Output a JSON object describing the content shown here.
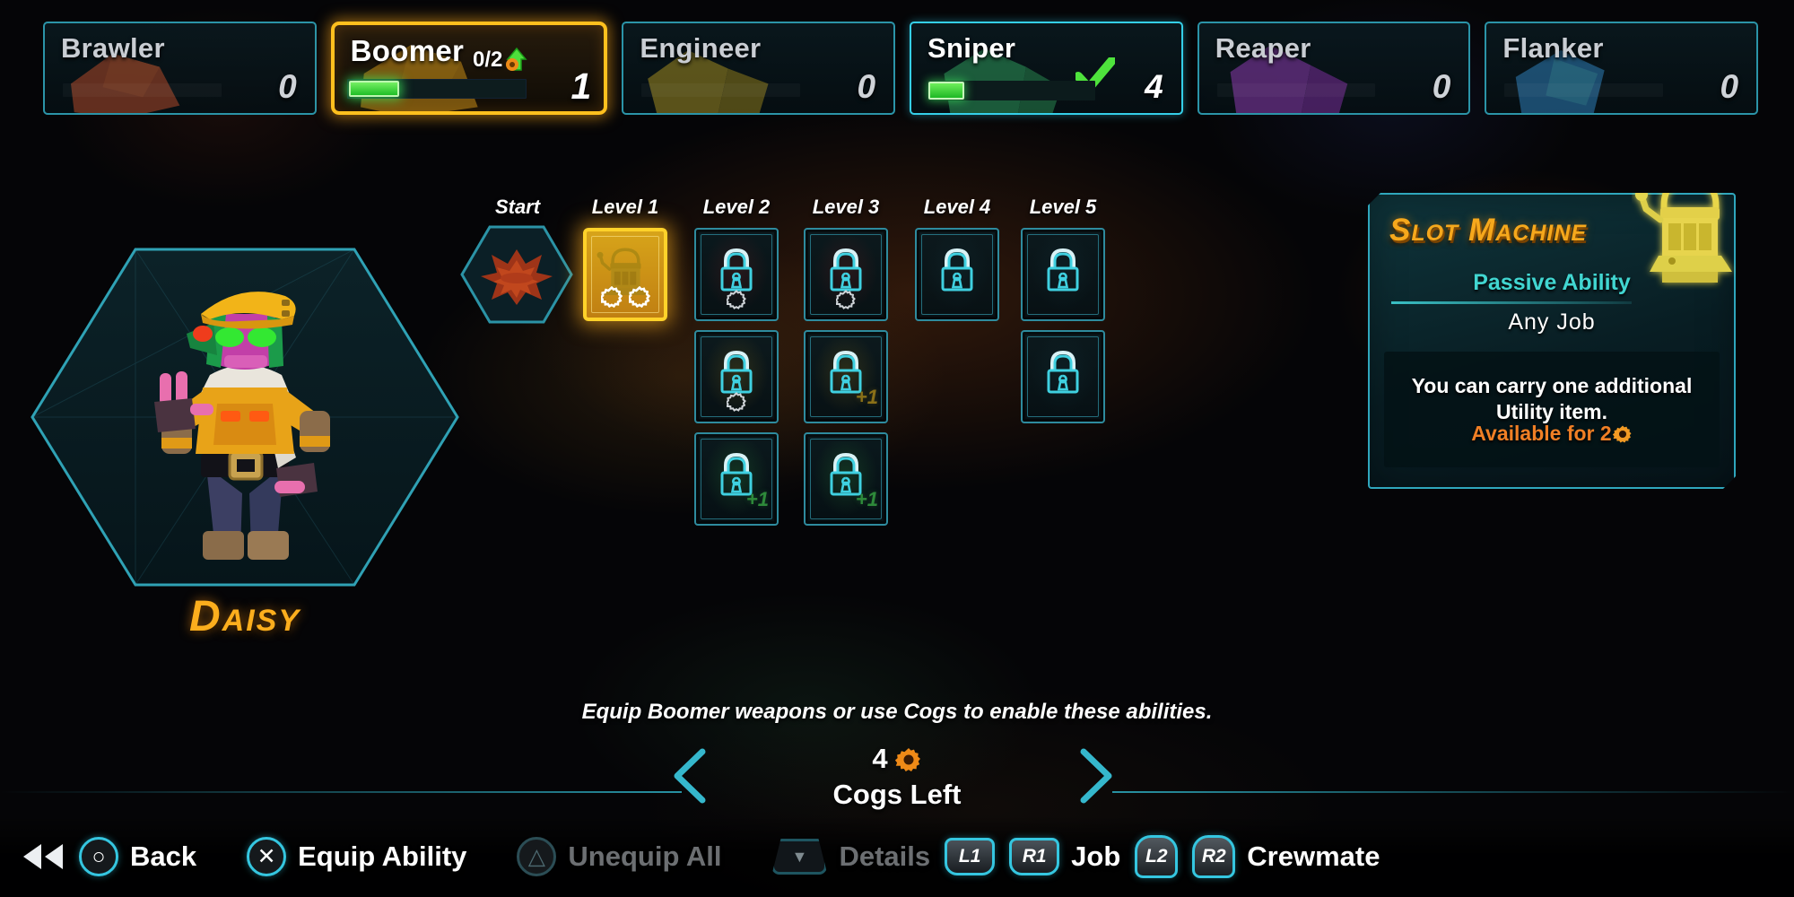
{
  "jobs": [
    {
      "name": "Brawler",
      "count": "0",
      "state": "locked",
      "accent": "#b04a2a"
    },
    {
      "name": "Boomer",
      "count": "1",
      "state": "selected",
      "accent": "#d89a18",
      "upgrade": "0/2",
      "progress": 8
    },
    {
      "name": "Engineer",
      "count": "0",
      "state": "locked",
      "accent": "#a08a22"
    },
    {
      "name": "Sniper",
      "count": "4",
      "state": "active",
      "accent": "#2f9a5c",
      "progress": 6,
      "checked": true
    },
    {
      "name": "Reaper",
      "count": "0",
      "state": "locked",
      "accent": "#8c3bb0"
    },
    {
      "name": "Flanker",
      "count": "0",
      "state": "locked",
      "accent": "#2f7fb8"
    }
  ],
  "character": {
    "name": "Daisy"
  },
  "tree": {
    "columns": [
      "Start",
      "Level 1",
      "Level 2",
      "Level 3",
      "Level 4",
      "Level 5"
    ],
    "nodes": [
      {
        "col": 0,
        "row": 0,
        "kind": "start",
        "icon": "explosion-icon",
        "state": "start",
        "cost": 0,
        "plus": ""
      },
      {
        "col": 1,
        "row": 0,
        "kind": "ability",
        "icon": "slot-machine-icon",
        "state": "selected",
        "cost": 2,
        "plus": ""
      },
      {
        "col": 2,
        "row": 0,
        "kind": "locked",
        "icon": "lock-icon",
        "state": "locked",
        "cost": 1,
        "plus": "",
        "tint": "#7a2020"
      },
      {
        "col": 2,
        "row": 1,
        "kind": "locked",
        "icon": "lock-icon",
        "state": "locked",
        "cost": 1,
        "plus": "",
        "tint": "#8a7018"
      },
      {
        "col": 2,
        "row": 2,
        "kind": "locked",
        "icon": "lock-icon",
        "state": "locked",
        "cost": 0,
        "plus": "+1",
        "tint": "#2e8a3a"
      },
      {
        "col": 3,
        "row": 0,
        "kind": "locked",
        "icon": "lock-icon",
        "state": "locked",
        "cost": 1,
        "plus": "",
        "tint": "#7a2020"
      },
      {
        "col": 3,
        "row": 1,
        "kind": "locked",
        "icon": "lock-icon",
        "state": "locked",
        "cost": 0,
        "plus": "+1",
        "tint": "#8a7018"
      },
      {
        "col": 3,
        "row": 2,
        "kind": "locked",
        "icon": "lock-icon",
        "state": "locked",
        "cost": 0,
        "plus": "+1",
        "tint": "#2e8a3a"
      },
      {
        "col": 4,
        "row": 0,
        "kind": "locked",
        "icon": "lock-icon",
        "state": "locked",
        "cost": 0,
        "plus": "",
        "tint": "#143840"
      },
      {
        "col": 5,
        "row": 0,
        "kind": "locked",
        "icon": "lock-icon",
        "state": "locked",
        "cost": 0,
        "plus": "",
        "tint": "#143840"
      },
      {
        "col": 5,
        "row": 1,
        "kind": "locked",
        "icon": "lock-icon",
        "state": "locked",
        "cost": 0,
        "plus": "",
        "tint": "#143840"
      }
    ]
  },
  "info_card": {
    "title": "Slot Machine",
    "subtitle": "Passive Ability",
    "job": "Any Job",
    "description": "You can carry one additional Utility item.",
    "available_prefix": "Available for ",
    "available_cost": "2"
  },
  "hint": "Equip Boomer weapons or use Cogs to enable these abilities.",
  "cogs": {
    "amount": "4",
    "label": "Cogs Left"
  },
  "bottom_bar": [
    {
      "button": "○",
      "pad": "round",
      "label": "Back",
      "dim": false
    },
    {
      "button": "✕",
      "pad": "round",
      "label": "Equip Ability",
      "dim": false
    },
    {
      "button": "△",
      "pad": "round",
      "label": "Unequip All",
      "dim": true
    },
    {
      "button": "▼",
      "pad": "trap",
      "label": "Details",
      "dim": true
    },
    {
      "button": "L1",
      "pad": "shoulder",
      "label": "",
      "dim": false
    },
    {
      "button": "R1",
      "pad": "shoulder",
      "label": "Job",
      "dim": false
    },
    {
      "button": "L2",
      "pad": "trigger",
      "label": "",
      "dim": false
    },
    {
      "button": "R2",
      "pad": "trigger",
      "label": "Crewmate",
      "dim": false
    }
  ],
  "colors": {
    "teal_border": "#2b94a8",
    "gold": "#ffc01e",
    "orange_text": "#f07f25",
    "green": "#2ec53a",
    "cyan_text": "#41d6d1"
  }
}
